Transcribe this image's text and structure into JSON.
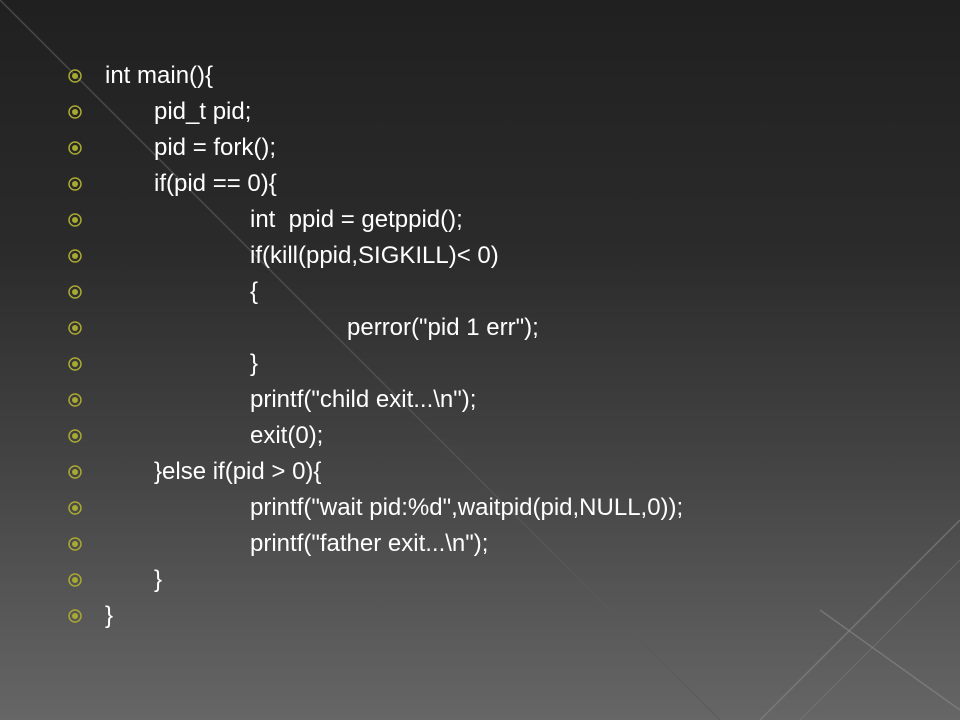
{
  "slide": {
    "bullet_color": "#a8a832",
    "text_color": "#ffffff",
    "bullet_icon": "circled-dot-bullet-icon",
    "lines": [
      {
        "text": "int main(){",
        "indent": 0
      },
      {
        "text": "pid_t pid;",
        "indent": 1
      },
      {
        "text": "pid = fork();",
        "indent": 1
      },
      {
        "text": "if(pid == 0){",
        "indent": 1
      },
      {
        "text": "int  ppid = getppid();",
        "indent": 2
      },
      {
        "text": "if(kill(ppid,SIGKILL)< 0)",
        "indent": 2
      },
      {
        "text": "{",
        "indent": 2
      },
      {
        "text": "perror(\"pid 1 err\");",
        "indent": 3
      },
      {
        "text": "}",
        "indent": 2
      },
      {
        "text": "printf(\"child exit...\\n\");",
        "indent": 2
      },
      {
        "text": "exit(0);",
        "indent": 2
      },
      {
        "text": "}else if(pid > 0){",
        "indent": 1
      },
      {
        "text": "printf(\"wait pid:%d\",waitpid(pid,NULL,0));",
        "indent": 2
      },
      {
        "text": "printf(\"father exit...\\n\");",
        "indent": 2
      },
      {
        "text": "}",
        "indent": 1
      },
      {
        "text": "}",
        "indent": 0
      }
    ]
  }
}
